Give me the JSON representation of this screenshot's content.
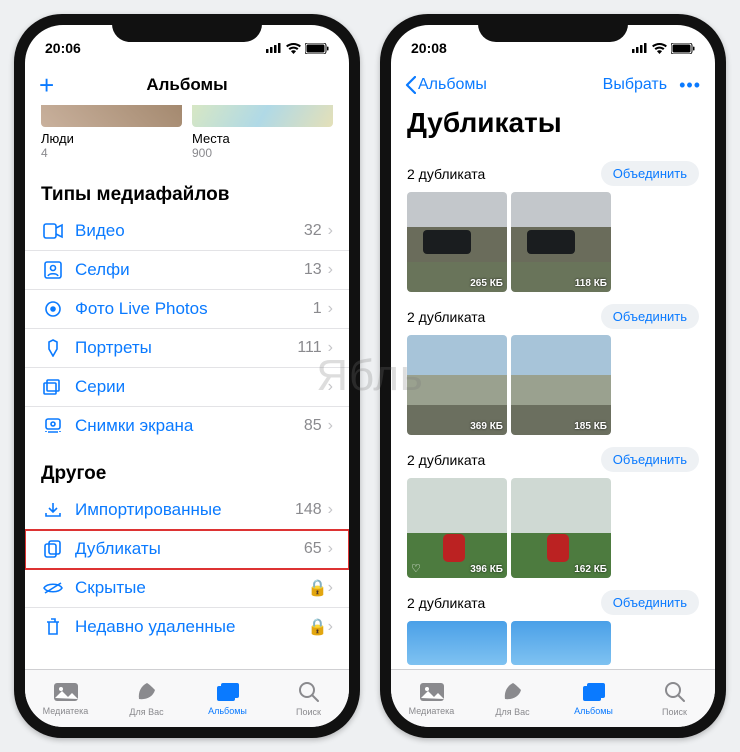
{
  "left": {
    "time": "20:06",
    "nav_title": "Альбомы",
    "pills": [
      {
        "label": "Люди",
        "count": "4"
      },
      {
        "label": "Места",
        "count": "900"
      }
    ],
    "section1": "Типы медиафайлов",
    "rows1": [
      {
        "label": "Видео",
        "count": "32"
      },
      {
        "label": "Селфи",
        "count": "13"
      },
      {
        "label": "Фото Live Photos",
        "count": "1"
      },
      {
        "label": "Портреты",
        "count": "111"
      },
      {
        "label": "Серии",
        "count": ""
      },
      {
        "label": "Снимки экрана",
        "count": "85"
      }
    ],
    "section2": "Другое",
    "rows2": [
      {
        "label": "Импортированные",
        "count": "148",
        "lock": false,
        "hl": false
      },
      {
        "label": "Дубликаты",
        "count": "65",
        "lock": false,
        "hl": true
      },
      {
        "label": "Скрытые",
        "count": "",
        "lock": true,
        "hl": false
      },
      {
        "label": "Недавно удаленные",
        "count": "",
        "lock": true,
        "hl": false
      }
    ]
  },
  "right": {
    "time": "20:08",
    "back_label": "Альбомы",
    "select_label": "Выбрать",
    "title": "Дубликаты",
    "merge_label": "Объединить",
    "groups": [
      {
        "label": "2 дубликата",
        "cls": "t-car",
        "sizes": [
          "265 КБ",
          "118 КБ"
        ],
        "heart": [
          false,
          false
        ]
      },
      {
        "label": "2 дубликата",
        "cls": "t-city",
        "sizes": [
          "369 КБ",
          "185 КБ"
        ],
        "heart": [
          false,
          false
        ]
      },
      {
        "label": "2 дубликата",
        "cls": "t-green",
        "sizes": [
          "396 КБ",
          "162 КБ"
        ],
        "heart": [
          true,
          false
        ]
      },
      {
        "label": "2 дубликата",
        "cls": "t-sky",
        "sizes": [
          "",
          ""
        ],
        "heart": [
          false,
          false
        ]
      }
    ]
  },
  "tabs": [
    {
      "label": "Медиатека"
    },
    {
      "label": "Для Вас"
    },
    {
      "label": "Альбомы"
    },
    {
      "label": "Поиск"
    }
  ],
  "watermark": "Ябль"
}
